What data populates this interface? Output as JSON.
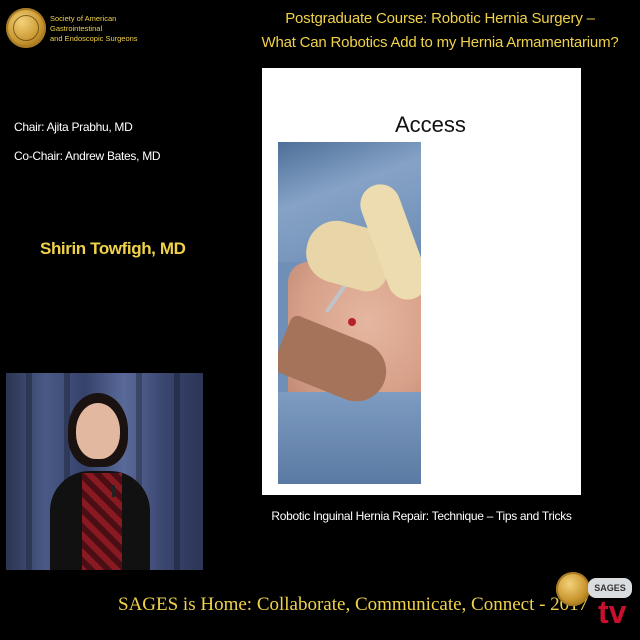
{
  "header": {
    "society_line1": "Society of American Gastrointestinal",
    "society_line2": "and Endoscopic Surgeons",
    "course_title_line1": "Postgraduate Course: Robotic Hernia Surgery –",
    "course_title_line2": "What Can Robotics Add to my Hernia Armamentarium?"
  },
  "sidebar": {
    "chair": "Chair: Ajita Prabhu, MD",
    "cochair": "Co-Chair: Andrew Bates, MD",
    "speaker": "Shirin Towfigh, MD"
  },
  "slide": {
    "title": "Access",
    "caption": "Robotic Inguinal Hernia Repair: Technique – Tips and Tricks"
  },
  "footer": {
    "banner": "SAGES is Home: Collaborate, Communicate, Connect - 2017",
    "tv_badge": "SAGES",
    "tv_letters": "tv"
  },
  "colors": {
    "accent_gold": "#f0d24a",
    "background": "#000000"
  }
}
